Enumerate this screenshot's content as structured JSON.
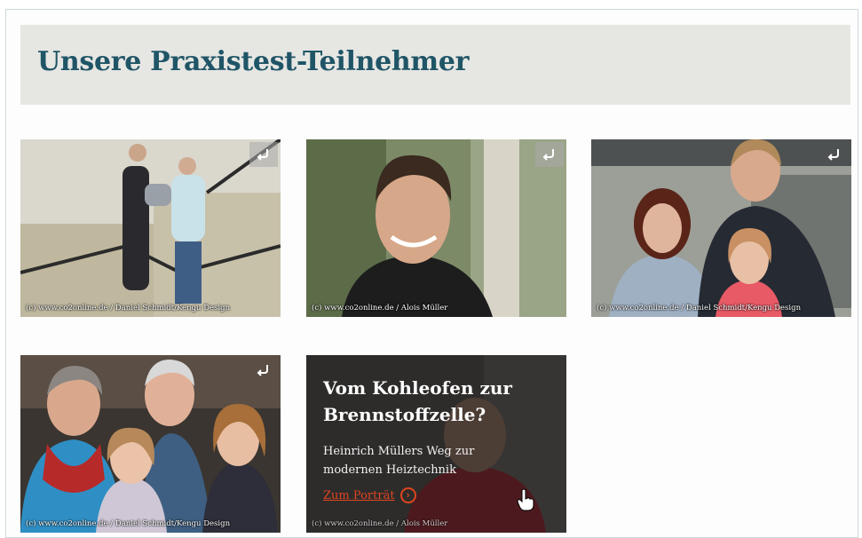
{
  "section": {
    "title": "Unsere Praxistest-Teilnehmer"
  },
  "cards": [
    {
      "credit": "(c) www.co2online.de / Daniel Schmidt/Kengu Design",
      "icon": "return-arrow-icon"
    },
    {
      "credit": "(c) www.co2online.de / Alois Müller",
      "icon": "return-arrow-icon"
    },
    {
      "credit": "(c) www.co2online.de / Daniel Schmidt/Kengu Design",
      "icon": "return-arrow-icon"
    },
    {
      "credit": "(c) www.co2online.de / Daniel Schmidt/Kengu Design",
      "icon": "return-arrow-icon"
    }
  ],
  "promo": {
    "title": "Vom Kohleofen zur Brennstoffzelle?",
    "subtitle": "Heinrich Müllers Weg zur modernen Heiztechnik",
    "link_label": "Zum Porträt",
    "link_icon": "chevron-right-circle-icon",
    "credit": "(c) www.co2online.de / Alois Müller"
  },
  "colors": {
    "title": "#1f5566",
    "header_band": "#e6e6e3",
    "link_accent": "#e0451f"
  }
}
